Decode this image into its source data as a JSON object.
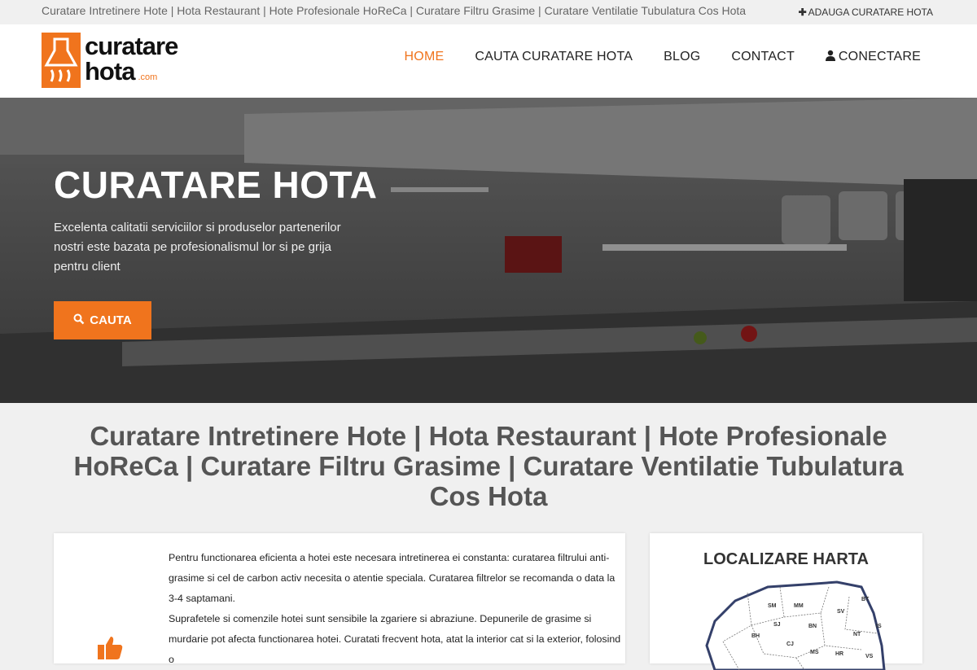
{
  "topbar": {
    "tagline": "Curatare Intretinere Hote | Hota Restaurant | Hote Profesionale HoReCa | Curatare Filtru Grasime | Curatare Ventilatie Tubulatura Cos Hota",
    "add_label": "ADAUGA CURATARE HOTA"
  },
  "logo": {
    "line1": "curatare",
    "line2": "hota",
    "suffix": ".com"
  },
  "nav": {
    "items": [
      {
        "label": "HOME",
        "active": true
      },
      {
        "label": "CAUTA CURATARE HOTA"
      },
      {
        "label": "BLOG"
      },
      {
        "label": "CONTACT"
      },
      {
        "label": "CONECTARE"
      }
    ]
  },
  "hero": {
    "title": "CURATARE HOTA",
    "text": "Excelenta calitatii serviciilor si produselor partenerilor nostri este bazata pe profesionalismul lor si pe grija pentru client",
    "button_label": "CAUTA"
  },
  "headline": "Curatare Intretinere Hote | Hota Restaurant | Hote Profesionale HoReCa | Curatare Filtru Grasime | Curatare Ventilatie Tubulatura Cos Hota",
  "article": {
    "p1": "Pentru functionarea eficienta a hotei este necesara intretinerea ei constanta: curatarea filtrului anti-grasime si cel de carbon activ necesita o atentie speciala. Curatarea filtrelor se recomanda o data la 3-4 saptamani.",
    "p2": "Suprafetele si comenzile hotei sunt sensibile la zgariere si abraziune. Depunerile de grasime si murdarie pot afecta functionarea hotei. Curatati frecvent hota, atat la interior cat si la exterior, folosind o"
  },
  "map_box": {
    "title": "LOCALIZARE HARTA",
    "counties": [
      "BT",
      "SM",
      "MM",
      "SV",
      "BH",
      "SJ",
      "BN",
      "NT",
      "IS",
      "CJ",
      "MS",
      "HR",
      "VS"
    ]
  },
  "colors": {
    "accent": "#f0741d"
  }
}
